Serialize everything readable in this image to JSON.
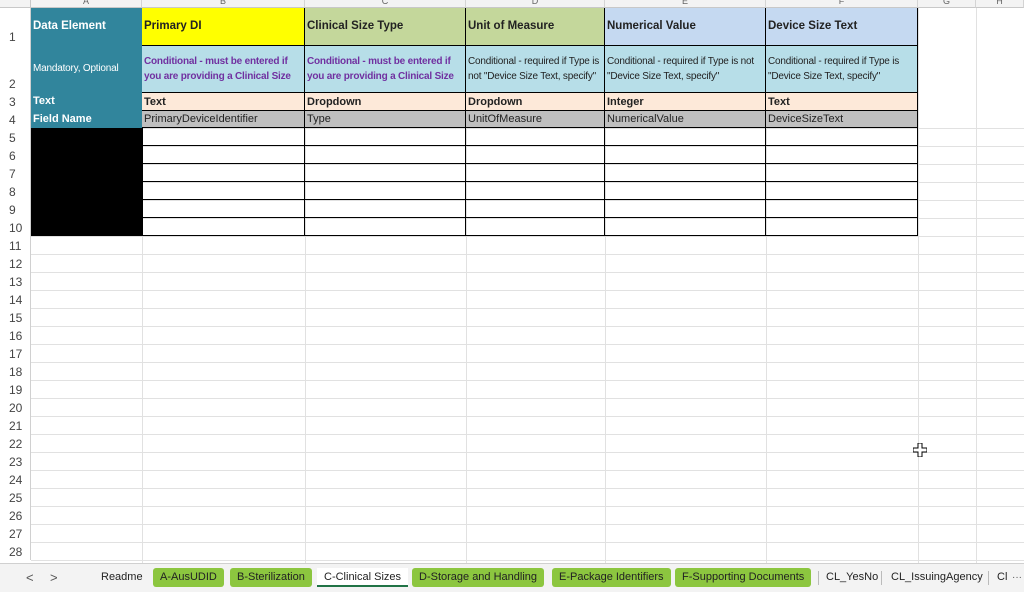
{
  "columns": [
    "A",
    "B",
    "C",
    "D",
    "E",
    "F",
    "G",
    "H"
  ],
  "rows": [
    "1",
    "2",
    "3",
    "4",
    "5",
    "6",
    "7",
    "8",
    "9",
    "10",
    "11",
    "12",
    "13",
    "14",
    "15",
    "16",
    "17",
    "18",
    "19",
    "20",
    "21",
    "22",
    "23",
    "24",
    "25",
    "26",
    "27",
    "28"
  ],
  "header_row": {
    "a": "Data Element Name",
    "b": "Primary DI",
    "c": "Clinical Size Type",
    "d": "Unit of Measure",
    "e": "Numerical Value",
    "f": "Device Size Text"
  },
  "requirement_row": {
    "a": "Mandatory, Optional",
    "b": "Conditional - must be entered if you are providing a Clinical Size",
    "c": "Conditional - must be entered if you are providing a Clinical Size",
    "d": "Conditional - required if Type is not \"Device Size Text, specify\"",
    "e": "Conditional - required if Type is not \"Device Size Text, specify\"",
    "f": "Conditional - required if Type is \"Device Size Text, specify\""
  },
  "type_row": {
    "a": "Text",
    "b": "Text",
    "c": "Dropdown",
    "d": "Dropdown",
    "e": "Integer",
    "f": "Text"
  },
  "field_row": {
    "a": "Field Name",
    "b": "PrimaryDeviceIdentifier",
    "c": "Type",
    "d": "UnitOfMeasure",
    "e": "NumericalValue",
    "f": "DeviceSizeText"
  },
  "colors": {
    "teal": "#31859c",
    "yellow": "#ffff00",
    "green": "#c4d79b",
    "blue": "#c5d9f1",
    "lightblue": "#b7dee8",
    "peach": "#fde9d9",
    "gray": "#bfbfbf",
    "black": "#000000",
    "tab_green": "#8cc63f"
  },
  "tabs": [
    {
      "label": "Readme",
      "style": "plain"
    },
    {
      "label": "A-AusUDID",
      "style": "green"
    },
    {
      "label": "B-Sterilization",
      "style": "green"
    },
    {
      "label": "C-Clinical Sizes",
      "style": "active"
    },
    {
      "label": "D-Storage and Handling",
      "style": "green"
    },
    {
      "label": "E-Package Identifiers",
      "style": "green"
    },
    {
      "label": "F-Supporting Documents",
      "style": "green"
    },
    {
      "label": "CL_YesNo",
      "style": "plain"
    },
    {
      "label": "CL_IssuingAgency",
      "style": "plain"
    },
    {
      "label": "Cl",
      "style": "plain"
    }
  ],
  "tab_nav": {
    "prev": "<",
    "next": ">",
    "more": "···"
  }
}
